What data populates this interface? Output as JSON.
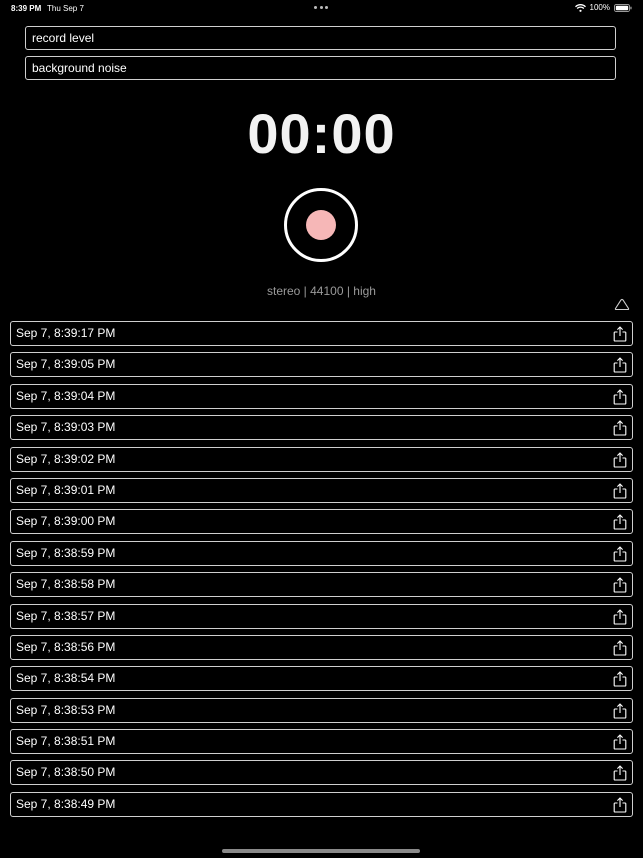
{
  "status_bar": {
    "time": "8:39 PM",
    "date": "Thu Sep 7",
    "battery": "100%"
  },
  "fields": {
    "record_level": "record level",
    "background_noise": "background noise"
  },
  "timer": {
    "value": "00:00"
  },
  "record_button": {
    "dot_color": "#f6b7b7"
  },
  "settings_summary": "stereo | 44100 | high",
  "recordings": [
    "Sep 7, 8:39:17 PM",
    "Sep 7, 8:39:05 PM",
    "Sep 7, 8:39:04 PM",
    "Sep 7, 8:39:03 PM",
    "Sep 7, 8:39:02 PM",
    "Sep 7, 8:39:01 PM",
    "Sep 7, 8:39:00 PM",
    "Sep 7, 8:38:59 PM",
    "Sep 7, 8:38:58 PM",
    "Sep 7, 8:38:57 PM",
    "Sep 7, 8:38:56 PM",
    "Sep 7, 8:38:54 PM",
    "Sep 7, 8:38:53 PM",
    "Sep 7, 8:38:51 PM",
    "Sep 7, 8:38:50 PM",
    "Sep 7, 8:38:49 PM"
  ],
  "icons": {
    "wifi": "wifi-icon",
    "battery": "battery-icon",
    "collapse": "chevron-up-icon",
    "share": "share-icon"
  }
}
